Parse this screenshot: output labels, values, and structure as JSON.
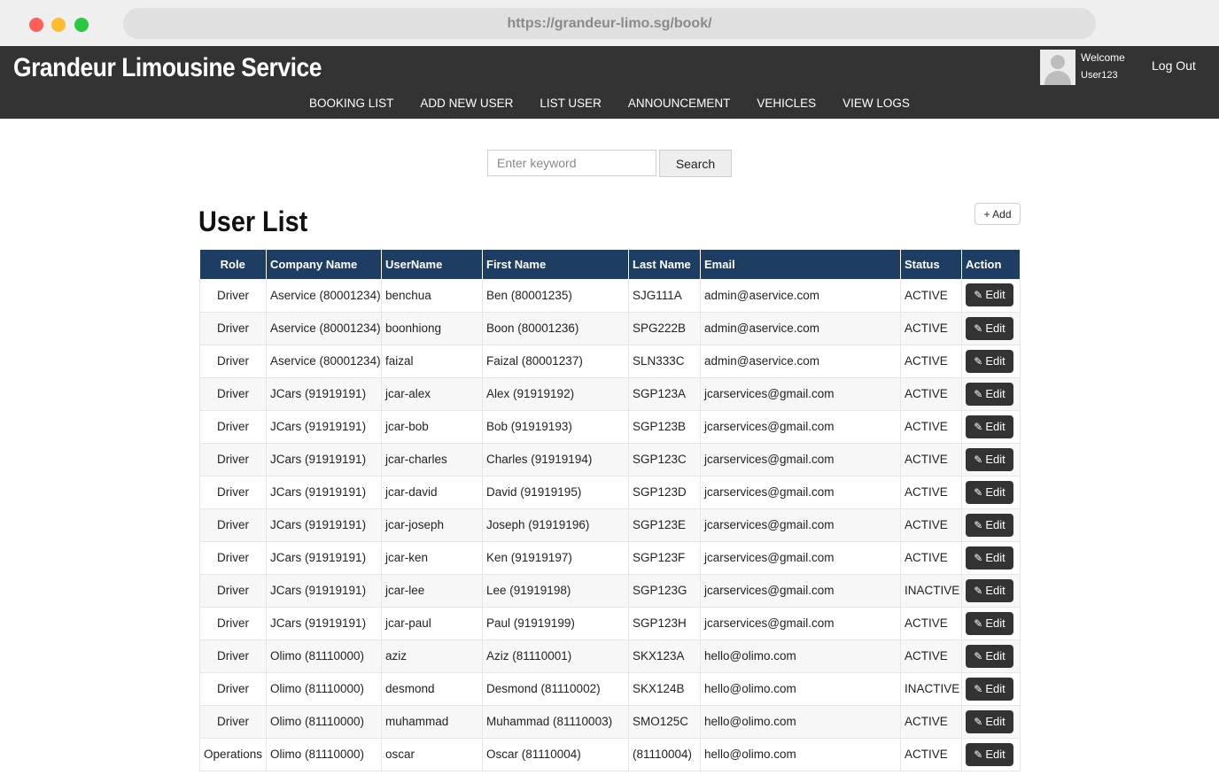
{
  "browser": {
    "url": "https://grandeur-limo.sg/book/"
  },
  "header": {
    "brand": "Grandeur Limousine Service",
    "welcome": "Welcome",
    "username": "User123",
    "logout": "Log Out"
  },
  "nav": {
    "items": [
      "BOOKING LIST",
      "ADD NEW USER",
      "LIST USER",
      "ANNOUNCEMENT",
      "VEHICLES",
      "VIEW LOGS"
    ]
  },
  "search": {
    "placeholder": "Enter keyword",
    "button": "Search"
  },
  "page": {
    "title": "User List",
    "add_label": "+ Add"
  },
  "table": {
    "columns": [
      "Role",
      "Company Name",
      "UserName",
      "First Name",
      "Last Name",
      "Email",
      "Status",
      "Action"
    ],
    "edit_label": "Edit",
    "rows": [
      [
        "Driver",
        "Aservice (80001234)",
        "benchua",
        "Ben (80001235)",
        "SJG111A",
        "admin@aservice.com",
        "ACTIVE"
      ],
      [
        "Driver",
        "Aservice (80001234)",
        "boonhiong",
        "Boon (80001236)",
        "SPG222B",
        "admin@aservice.com",
        "ACTIVE"
      ],
      [
        "Driver",
        "Aservice (80001234)",
        "faizal",
        "Faizal (80001237)",
        "SLN333C",
        "admin@aservice.com",
        "ACTIVE"
      ],
      [
        "Driver",
        "JCars (91919191)",
        "jcar-alex",
        "Alex (91919192)",
        "SGP123A",
        "jcarservices@gmail.com",
        "ACTIVE"
      ],
      [
        "Driver",
        "JCars (91919191)",
        "jcar-bob",
        "Bob (91919193)",
        "SGP123B",
        "jcarservices@gmail.com",
        "ACTIVE"
      ],
      [
        "Driver",
        "JCars (91919191)",
        "jcar-charles",
        "Charles (91919194)",
        "SGP123C",
        "jcarservices@gmail.com",
        "ACTIVE"
      ],
      [
        "Driver",
        "JCars (91919191)",
        "jcar-david",
        "David (91919195)",
        "SGP123D",
        "jcarservices@gmail.com",
        "ACTIVE"
      ],
      [
        "Driver",
        "JCars (91919191)",
        "jcar-joseph",
        "Joseph (91919196)",
        "SGP123E",
        "jcarservices@gmail.com",
        "ACTIVE"
      ],
      [
        "Driver",
        "JCars (91919191)",
        "jcar-ken",
        "Ken (91919197)",
        "SGP123F",
        "jcarservices@gmail.com",
        "ACTIVE"
      ],
      [
        "Driver",
        "JCars (91919191)",
        "jcar-lee",
        "Lee (91919198)",
        "SGP123G",
        "jcarservices@gmail.com",
        "INACTIVE"
      ],
      [
        "Driver",
        "JCars (91919191)",
        "jcar-paul",
        "Paul (91919199)",
        "SGP123H",
        "jcarservices@gmail.com",
        "ACTIVE"
      ],
      [
        "Driver",
        "Olimo (81110000)",
        "aziz",
        "Aziz (81110001)",
        "SKX123A",
        "hello@olimo.com",
        "ACTIVE"
      ],
      [
        "Driver",
        "Olimo (81110000)",
        "desmond",
        "Desmond (81110002)",
        "SKX124B",
        "hello@olimo.com",
        "INACTIVE"
      ],
      [
        "Driver",
        "Olimo (81110000)",
        "muhammad",
        "Muhammad (81110003)",
        "SMO125C",
        "hello@olimo.com",
        "ACTIVE"
      ],
      [
        "Operations",
        "Olimo (81110000)",
        "oscar",
        "Oscar (81110004)",
        "(81110004)",
        "hello@olimo.com",
        "ACTIVE"
      ]
    ]
  },
  "icons": {
    "edit": "pencil-icon",
    "avatar": "user-avatar-icon"
  },
  "colors": {
    "header_bg": "#333333",
    "table_header_bg": "#1d3d63",
    "edit_button_bg": "#333333"
  }
}
